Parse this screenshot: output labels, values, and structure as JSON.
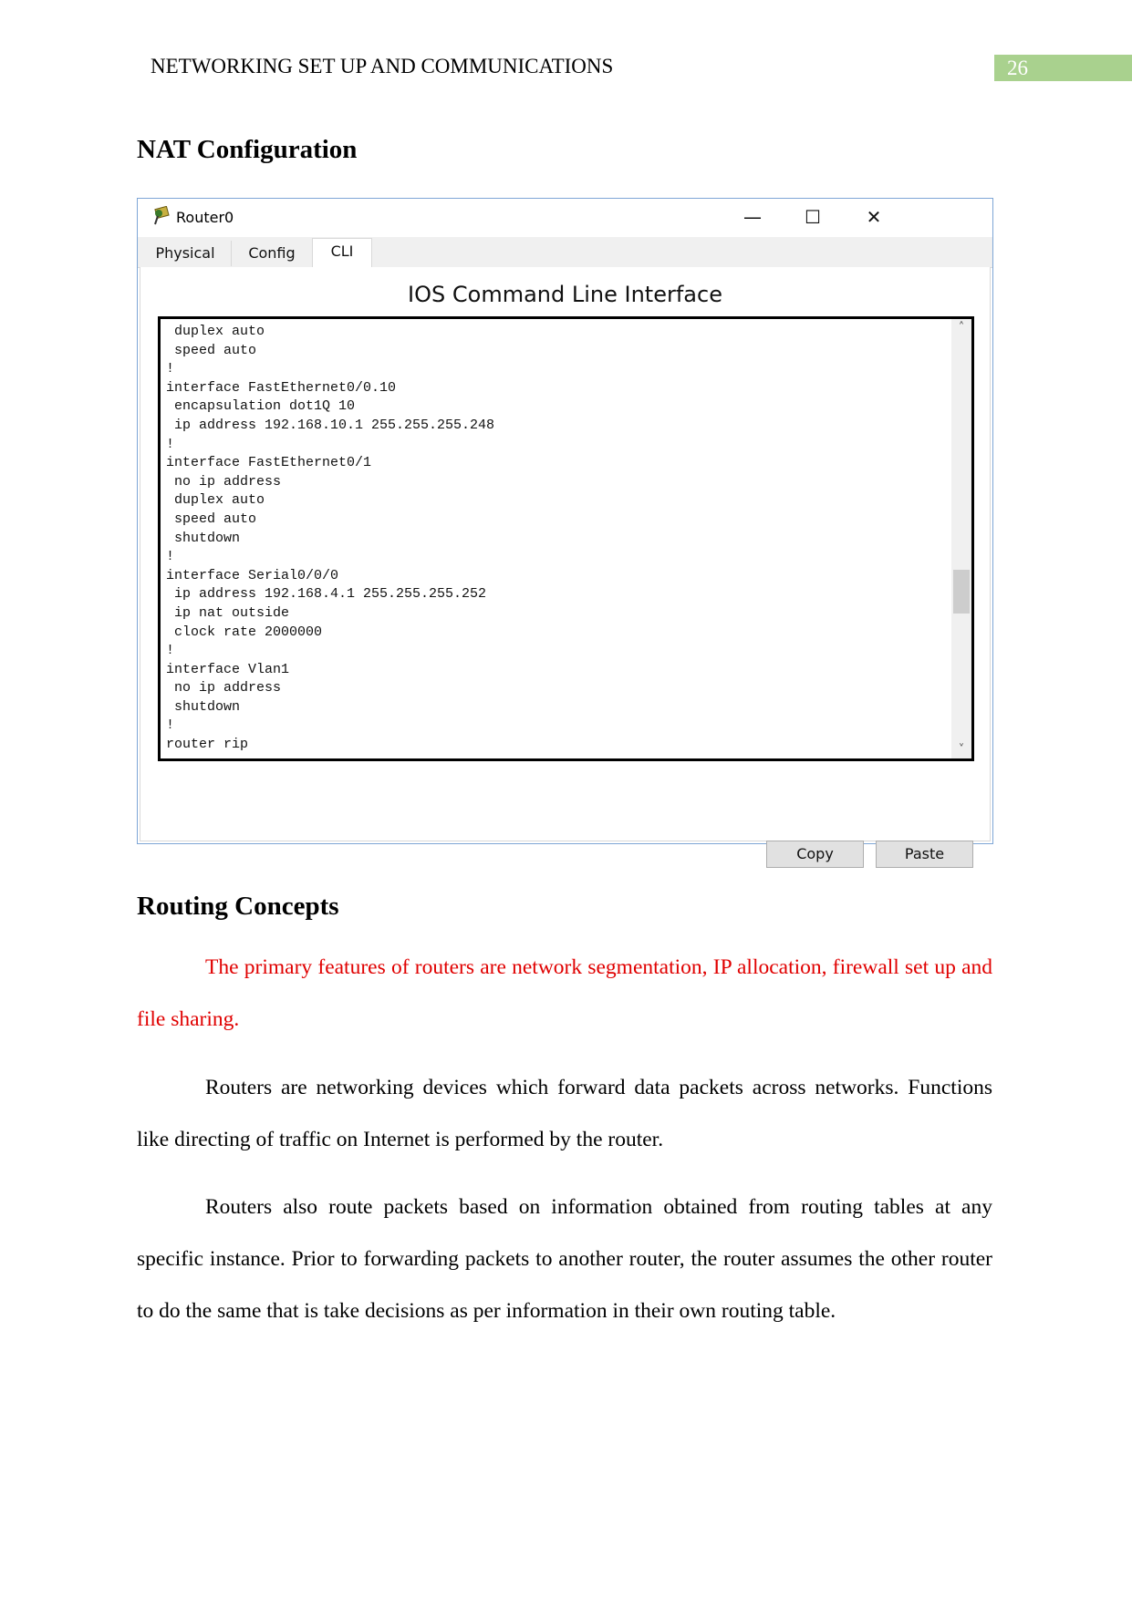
{
  "header": {
    "running_title": "NETWORKING SET UP AND COMMUNICATIONS",
    "page_number": "26",
    "page_box_color": "#a9d18e"
  },
  "section1": {
    "heading": "NAT Configuration"
  },
  "window": {
    "title": "Router0",
    "icon": "router-icon",
    "controls": {
      "minimize": "—",
      "maximize": "☐",
      "close": "✕"
    },
    "tabs": [
      {
        "label": "Physical"
      },
      {
        "label": "Config"
      },
      {
        "label": "CLI",
        "active": true
      }
    ],
    "cli_title": "IOS Command Line Interface",
    "terminal_text": " duplex auto\n speed auto\n!\ninterface FastEthernet0/0.10\n encapsulation dot1Q 10\n ip address 192.168.10.1 255.255.255.248\n!\ninterface FastEthernet0/1\n no ip address\n duplex auto\n speed auto\n shutdown\n!\ninterface Serial0/0/0\n ip address 192.168.4.1 255.255.255.252\n ip nat outside\n clock rate 2000000\n!\ninterface Vlan1\n no ip address\n shutdown\n!\nrouter rip",
    "buttons": {
      "copy": "Copy",
      "paste": "Paste"
    }
  },
  "section2": {
    "heading": "Routing Concepts",
    "paragraphs": [
      "The primary features of routers are network segmentation, IP allocation, firewall set up and file sharing.",
      "Routers are networking devices which forward data packets across networks. Functions like directing of traffic on Internet is performed by the router.",
      "Routers also route packets based on information obtained from routing tables at any specific instance. Prior to forwarding packets to another router, the router assumes the other router to do the same that is take decisions as per information in their own routing table."
    ],
    "highlight_color": "#e00000"
  }
}
